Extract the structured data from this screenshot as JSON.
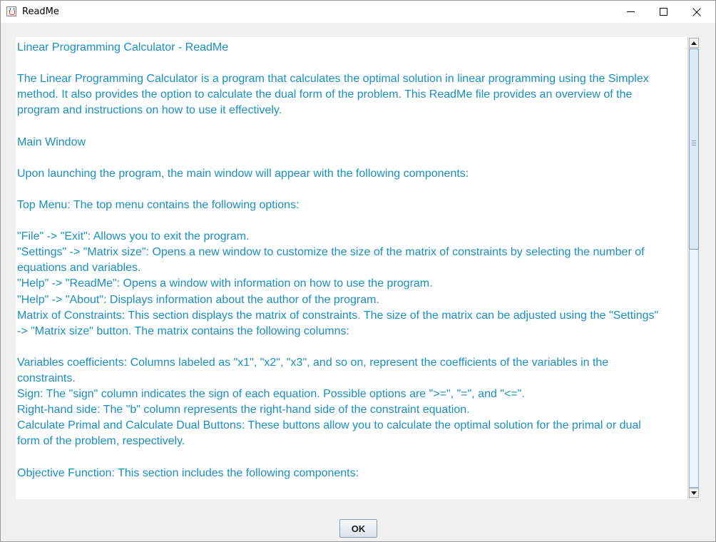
{
  "window": {
    "title": "ReadMe",
    "controls": {
      "minimize_icon": "minimize-icon",
      "maximize_icon": "maximize-icon",
      "close_icon": "close-icon"
    }
  },
  "readme": {
    "text_color": "#1a8fc1",
    "lines": [
      "Linear Programming Calculator - ReadMe",
      "",
      "The Linear Programming Calculator is a program that calculates the optimal solution in linear programming using the Simplex",
      "method. It also provides the option to calculate the dual form of the problem. This ReadMe file provides an overview of the",
      "program and instructions on how to use it effectively.",
      "",
      "Main Window",
      "",
      "Upon launching the program, the main window will appear with the following components:",
      "",
      "Top Menu: The top menu contains the following options:",
      "",
      "\"File\" -> \"Exit\": Allows you to exit the program.",
      "\"Settings\" -> \"Matrix size\": Opens a new window to customize the size of the matrix of constraints by selecting the number of",
      "equations and variables.",
      "\"Help\" -> \"ReadMe\": Opens a window with information on how to use the program.",
      "\"Help\" -> \"About\": Displays information about the author of the program.",
      "Matrix of Constraints: This section displays the matrix of constraints. The size of the matrix can be adjusted using the \"Settings\"",
      "-> \"Matrix size\" button. The matrix contains the following columns:",
      "",
      "Variables coefficients: Columns labeled as \"x1\", \"x2\", \"x3\", and so on, represent the coefficients of the variables in the",
      "constraints.",
      "Sign: The \"sign\" column indicates the sign of each equation. Possible options are \">=\", \"=\", and \"<=\".",
      "Right-hand side: The \"b\" column represents the right-hand side of the constraint equation.",
      "Calculate Primal and Calculate Dual Buttons: These buttons allow you to calculate the optimal solution for the primal or dual",
      "form of the problem, respectively.",
      "",
      "Objective Function: This section includes the following components:",
      ""
    ]
  },
  "buttons": {
    "ok_label": "OK"
  }
}
